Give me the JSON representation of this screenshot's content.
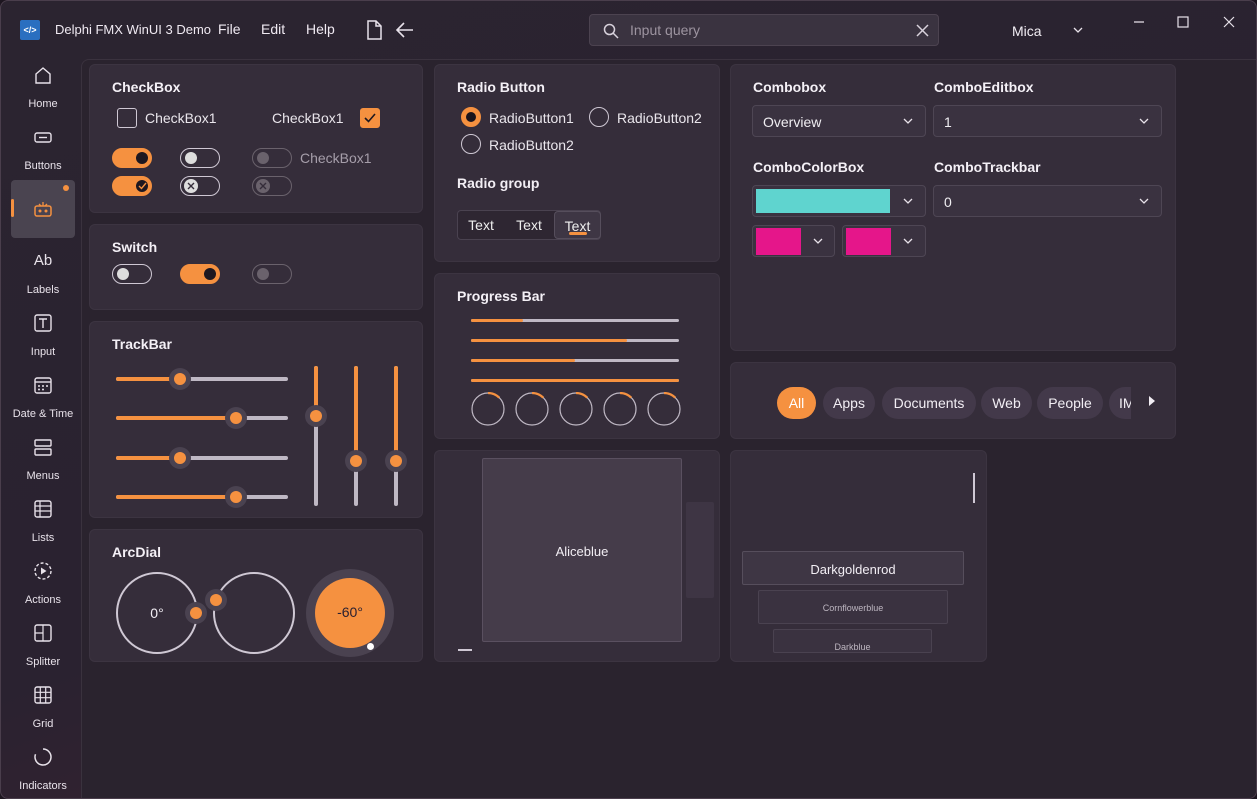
{
  "app": {
    "title": "Delphi FMX WinUI 3 Demo",
    "logo_text": "</>"
  },
  "menu": {
    "file": "File",
    "edit": "Edit",
    "help": "Help"
  },
  "search": {
    "placeholder": "Input query"
  },
  "theme": {
    "label": "Mica"
  },
  "sidebar": {
    "items": [
      {
        "label": "Home",
        "icon": "home-icon"
      },
      {
        "label": "Buttons",
        "icon": "button-icon"
      },
      {
        "label": "",
        "icon": "robot-icon"
      },
      {
        "label": "Labels",
        "icon": "text-ab-icon"
      },
      {
        "label": "Input",
        "icon": "input-icon"
      },
      {
        "label": "Date & Time",
        "icon": "calendar-icon"
      },
      {
        "label": "Menus",
        "icon": "menu-icon"
      },
      {
        "label": "Lists",
        "icon": "list-icon"
      },
      {
        "label": "Actions",
        "icon": "play-icon"
      },
      {
        "label": "Splitter",
        "icon": "splitter-icon"
      },
      {
        "label": "Grid",
        "icon": "grid-icon"
      },
      {
        "label": "Indicators",
        "icon": "spinner-icon"
      }
    ]
  },
  "checkbox": {
    "title": "CheckBox",
    "item1": "CheckBox1",
    "item2": "CheckBox1",
    "item3": "CheckBox1"
  },
  "switch": {
    "title": "Switch"
  },
  "trackbar": {
    "title": "TrackBar",
    "horizontal_values": [
      0.37,
      0.7,
      0.37,
      0.7
    ],
    "vertical_values": [
      0.64,
      0.32,
      0.32
    ]
  },
  "arcdial": {
    "title": "ArcDial",
    "dial1": "0°",
    "dial3": "-60°"
  },
  "radio": {
    "title": "Radio Button",
    "opt1": "RadioButton1",
    "opt2": "RadioButton2",
    "opt3": "RadioButton2",
    "group_title": "Radio group",
    "group": [
      "Text",
      "Text",
      "Text"
    ]
  },
  "progress": {
    "title": "Progress Bar",
    "values": [
      0.25,
      0.75,
      0.5,
      1.0
    ]
  },
  "combos": {
    "combobox_title": "Combobox",
    "combobox_value": "Overview",
    "comboedit_title": "ComboEditbox",
    "comboedit_value": "1",
    "colorbox_title": "ComboColorBox",
    "colorbox_color": "#5fd4cf",
    "color2": "#e5168a",
    "color3": "#e5168a",
    "trackbar_title": "ComboTrackbar",
    "trackbar_value": "0"
  },
  "filters": {
    "items": [
      "All",
      "Apps",
      "Documents",
      "Web",
      "People",
      "IM"
    ],
    "active": "All"
  },
  "colors": {
    "aliceblue": "Aliceblue",
    "darkgoldenrod": "Darkgoldenrod",
    "cornflowerblue": "Cornflowerblue",
    "darkblue": "Darkblue"
  },
  "accent": "#f59140"
}
